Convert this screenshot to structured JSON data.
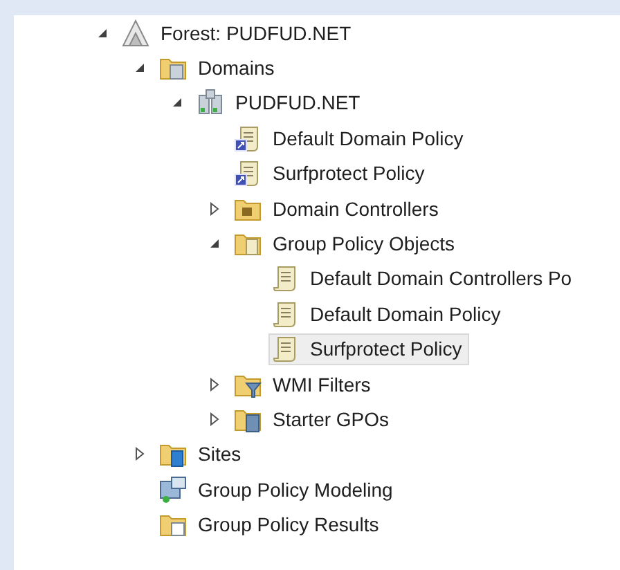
{
  "tree": [
    {
      "label": "Forest: PUDFUD.NET",
      "kind": "forest",
      "expanded": true,
      "selected": false,
      "children": [
        {
          "label": "Domains",
          "kind": "domains",
          "expanded": true,
          "selected": false,
          "children": [
            {
              "label": "PUDFUD.NET",
              "kind": "domain",
              "expanded": true,
              "selected": false,
              "children": [
                {
                  "label": "Default Domain Policy",
                  "kind": "gpo-link",
                  "selected": false
                },
                {
                  "label": "Surfprotect Policy",
                  "kind": "gpo-link",
                  "selected": false
                },
                {
                  "label": "Domain Controllers",
                  "kind": "ou",
                  "expanded": false,
                  "selected": false
                },
                {
                  "label": "Group Policy Objects",
                  "kind": "gpo-folder",
                  "expanded": true,
                  "selected": false,
                  "children": [
                    {
                      "label": "Default Domain Controllers Po",
                      "kind": "gpo",
                      "selected": false
                    },
                    {
                      "label": "Default Domain Policy",
                      "kind": "gpo",
                      "selected": false
                    },
                    {
                      "label": "Surfprotect Policy",
                      "kind": "gpo",
                      "selected": true
                    }
                  ]
                },
                {
                  "label": "WMI Filters",
                  "kind": "wmi-folder",
                  "expanded": false,
                  "selected": false
                },
                {
                  "label": "Starter GPOs",
                  "kind": "starter-folder",
                  "expanded": false,
                  "selected": false
                }
              ]
            }
          ]
        },
        {
          "label": "Sites",
          "kind": "sites",
          "expanded": false,
          "selected": false
        },
        {
          "label": "Group Policy Modeling",
          "kind": "modeling",
          "selected": false
        },
        {
          "label": "Group Policy Results",
          "kind": "results",
          "selected": false
        }
      ]
    }
  ]
}
